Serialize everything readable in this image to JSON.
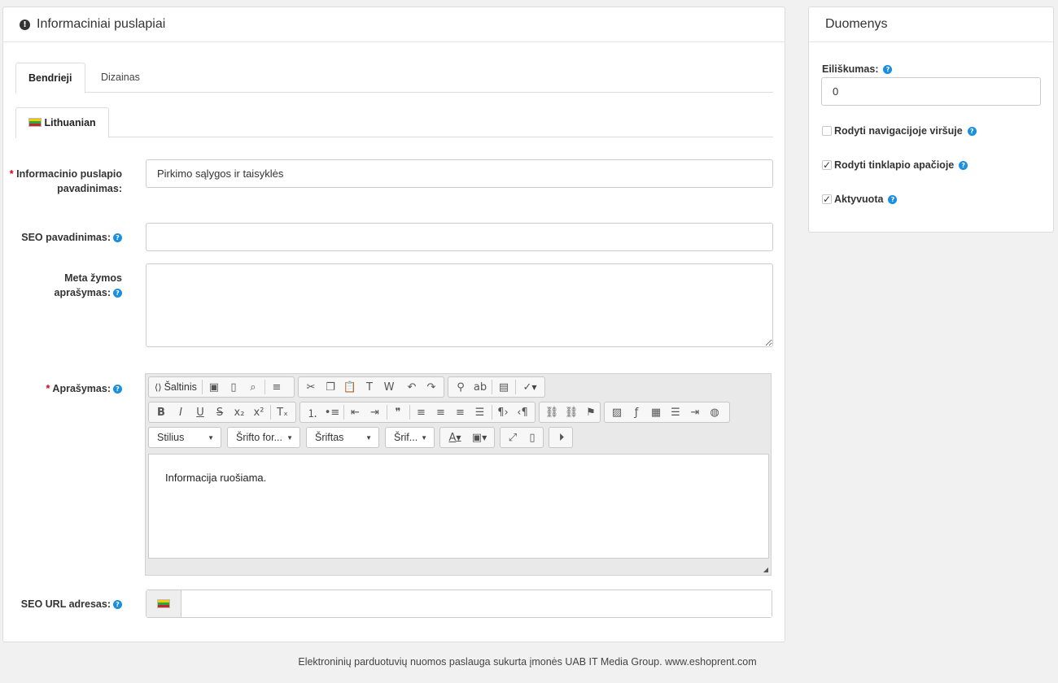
{
  "main_panel": {
    "title": "Informaciniai puslapiai",
    "tabs": [
      {
        "label": "Bendrieji",
        "active": true
      },
      {
        "label": "Dizainas",
        "active": false
      }
    ],
    "language_tab": "Lithuanian",
    "fields": {
      "page_name": {
        "required_mark": "*",
        "label": "Informacinio puslapio pavadinimas:",
        "value": "Pirkimo sąlygos ir taisyklės"
      },
      "seo_title": {
        "label": "SEO pavadinimas:",
        "value": ""
      },
      "meta_description": {
        "label": "Meta žymos aprašymas:",
        "value": ""
      },
      "description": {
        "required_mark": "*",
        "label": "Aprašymas:"
      },
      "seo_url": {
        "label": "SEO URL adresas:",
        "value": ""
      }
    },
    "editor": {
      "source_label": "Šaltinis",
      "combos": [
        "Stilius",
        "Šrifto for...",
        "Šriftas",
        "Šrif..."
      ],
      "content": "Informacija ruošiama."
    }
  },
  "side_panel": {
    "title": "Duomenys",
    "priority_label": "Eiliškumas:",
    "priority_value": "0",
    "checkboxes": [
      {
        "label": "Rodyti navigacijoje viršuje",
        "checked": false
      },
      {
        "label": "Rodyti tinklapio apačioje",
        "checked": true
      },
      {
        "label": "Aktyvuota",
        "checked": true
      }
    ]
  },
  "help_glyph": "?",
  "warn_glyph": "!",
  "footer": "Elektroninių parduotuvių nuomos paslauga sukurta įmonės UAB IT Media Group. www.eshoprent.com",
  "colors": {
    "required": "#d9000f",
    "help": "#1a8fe0"
  }
}
